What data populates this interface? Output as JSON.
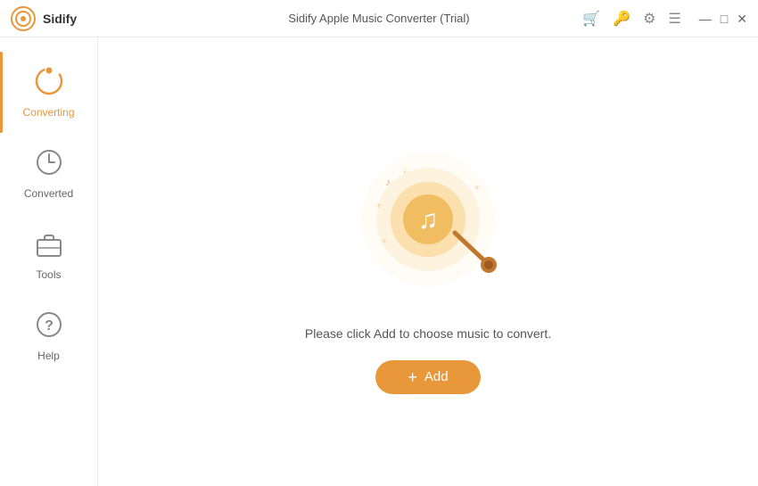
{
  "titlebar": {
    "brand": "Sidify",
    "title": "Sidify Apple Music Converter (Trial)"
  },
  "sidebar": {
    "items": [
      {
        "id": "converting",
        "label": "Converting",
        "active": true
      },
      {
        "id": "converted",
        "label": "Converted",
        "active": false
      },
      {
        "id": "tools",
        "label": "Tools",
        "active": false
      },
      {
        "id": "help",
        "label": "Help",
        "active": false
      }
    ]
  },
  "content": {
    "prompt": "Please click Add to choose music to convert.",
    "add_button": "+ Add"
  },
  "colors": {
    "accent": "#e8973a"
  }
}
